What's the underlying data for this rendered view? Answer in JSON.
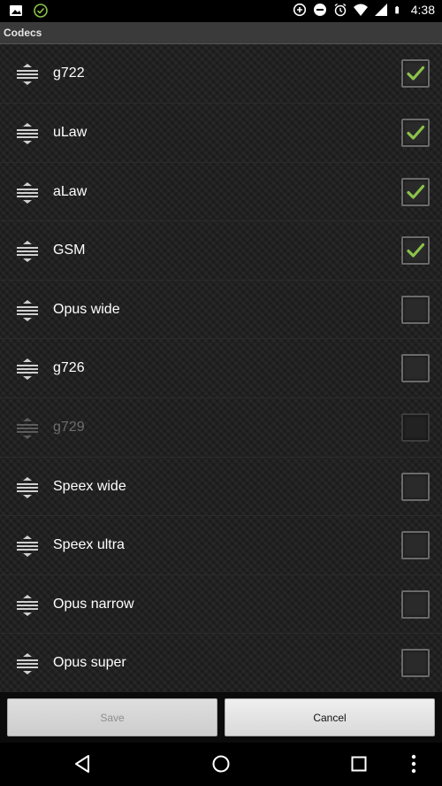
{
  "status_bar": {
    "time": "4:38",
    "left_icons": [
      "image-icon",
      "check-circle-icon"
    ],
    "right_icons": [
      "data-saver-icon",
      "do-not-disturb-icon",
      "alarm-icon",
      "wifi-icon",
      "signal-icon",
      "battery-icon"
    ]
  },
  "title": "Codecs",
  "codecs": [
    {
      "label": "g722",
      "checked": true,
      "enabled": true
    },
    {
      "label": "uLaw",
      "checked": true,
      "enabled": true
    },
    {
      "label": "aLaw",
      "checked": true,
      "enabled": true
    },
    {
      "label": "GSM",
      "checked": true,
      "enabled": true
    },
    {
      "label": "Opus wide",
      "checked": false,
      "enabled": true
    },
    {
      "label": "g726",
      "checked": false,
      "enabled": true
    },
    {
      "label": "g729",
      "checked": false,
      "enabled": false
    },
    {
      "label": "Speex wide",
      "checked": false,
      "enabled": true
    },
    {
      "label": "Speex ultra",
      "checked": false,
      "enabled": true
    },
    {
      "label": "Opus narrow",
      "checked": false,
      "enabled": true
    },
    {
      "label": "Opus super",
      "checked": false,
      "enabled": true
    }
  ],
  "buttons": {
    "save": "Save",
    "cancel": "Cancel"
  },
  "colors": {
    "check": "#8bc34a",
    "disabled_text": "#6d6d6d"
  },
  "nav_icons": [
    "back-icon",
    "home-icon",
    "recents-icon",
    "overflow-menu-icon"
  ]
}
